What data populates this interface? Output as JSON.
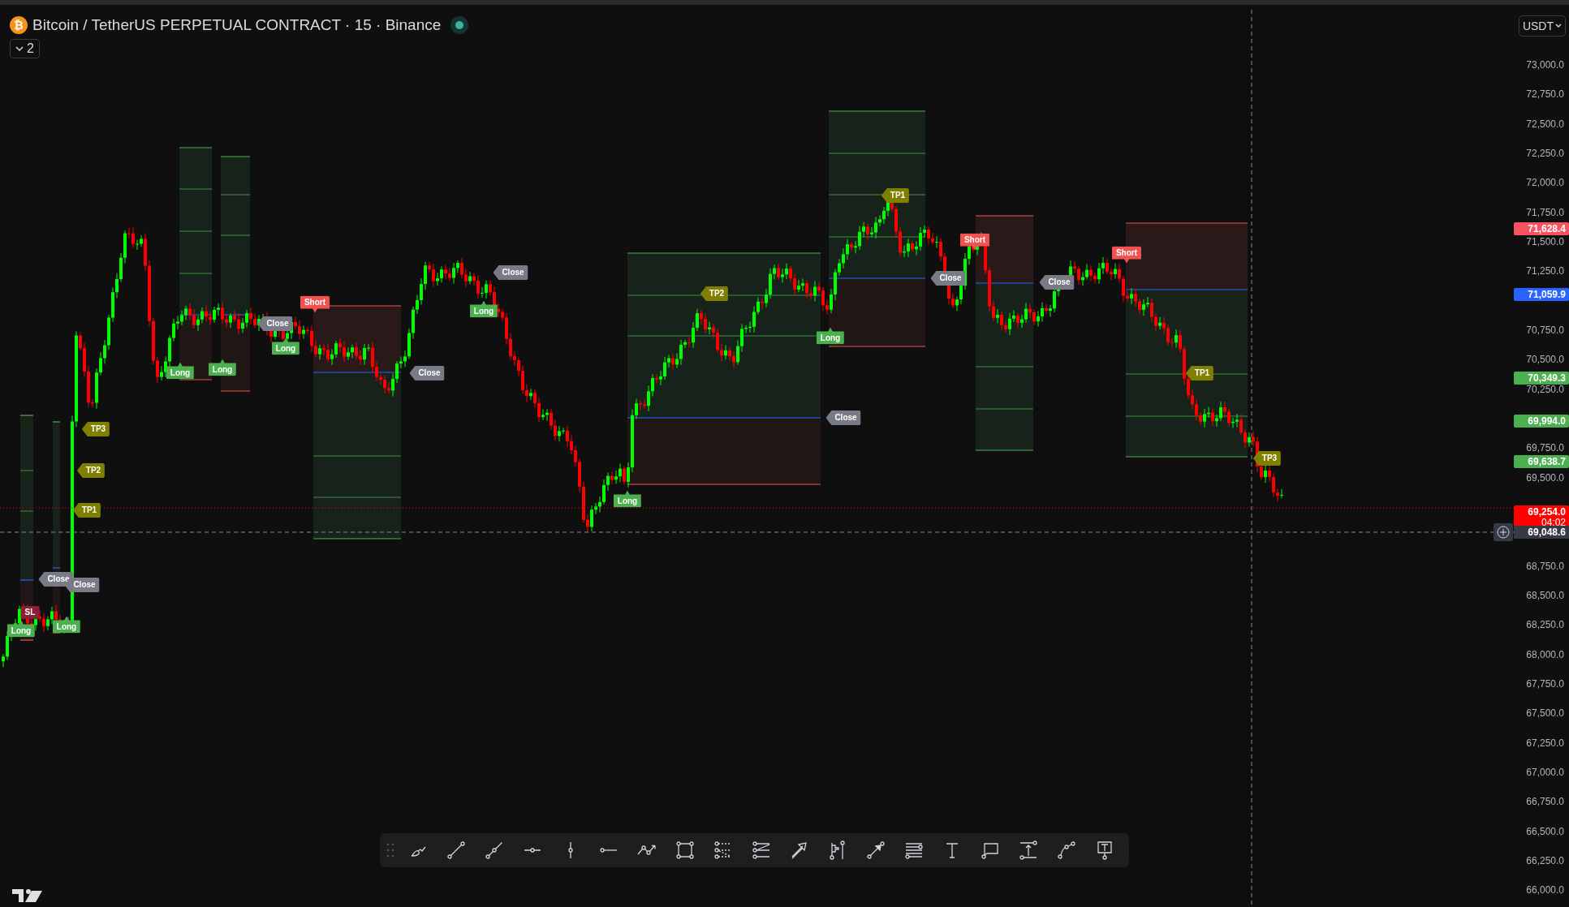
{
  "header": {
    "coin_symbol": "₿",
    "title": "Bitcoin / TetherUS PERPETUAL CONTRACT · 15 · Binance",
    "market_open": true,
    "indicator_count": "2"
  },
  "currency_menu": {
    "label": "USDT"
  },
  "price_axis": {
    "ticks": [
      "73,000.0",
      "72,750.0",
      "72,500.0",
      "72,250.0",
      "72,000.0",
      "71,750.0",
      "71,500.0",
      "71,250.0",
      "70,750.0",
      "70,500.0",
      "70,250.0",
      "69,750.0",
      "69,500.0",
      "68,750.0",
      "68,500.0",
      "68,250.0",
      "68,000.0",
      "67,750.0",
      "67,500.0",
      "67,250.0",
      "67,000.0",
      "66,750.0",
      "66,500.0",
      "66,250.0",
      "66,000.0"
    ],
    "badges": [
      {
        "text": "71,628.4",
        "color": "#f7525f"
      },
      {
        "text": "71,059.9",
        "color": "#2962ff"
      },
      {
        "text": "70,349.3",
        "color": "#4caf50"
      },
      {
        "text": "69,994.0",
        "color": "#4caf50"
      },
      {
        "text": "69,638.7",
        "color": "#4caf50"
      },
      {
        "text": "69,254.0",
        "countdown": "04:02",
        "color": "#ff0000"
      }
    ],
    "crosshair_price": "69,048.6"
  },
  "markers": [
    {
      "label": "TP3",
      "kind": "tp"
    },
    {
      "label": "TP2",
      "kind": "tp"
    },
    {
      "label": "TP1",
      "kind": "tp"
    },
    {
      "label": "Close",
      "kind": "close"
    },
    {
      "label": "Close",
      "kind": "close"
    },
    {
      "label": "SL",
      "kind": "sl"
    },
    {
      "label": "Long",
      "kind": "long"
    },
    {
      "label": "Long",
      "kind": "long"
    },
    {
      "label": "Long",
      "kind": "long"
    },
    {
      "label": "Long",
      "kind": "long"
    },
    {
      "label": "Close",
      "kind": "close"
    },
    {
      "label": "Short",
      "kind": "short"
    },
    {
      "label": "Close",
      "kind": "close"
    },
    {
      "label": "Long",
      "kind": "long"
    },
    {
      "label": "Close",
      "kind": "close"
    },
    {
      "label": "Long",
      "kind": "long"
    },
    {
      "label": "Long",
      "kind": "long"
    },
    {
      "label": "TP2",
      "kind": "tp"
    },
    {
      "label": "Close",
      "kind": "close"
    },
    {
      "label": "Long",
      "kind": "long"
    },
    {
      "label": "TP1",
      "kind": "tp"
    },
    {
      "label": "Close",
      "kind": "close"
    },
    {
      "label": "Short",
      "kind": "short"
    },
    {
      "label": "Close",
      "kind": "close"
    },
    {
      "label": "Short",
      "kind": "short"
    },
    {
      "label": "TP1",
      "kind": "tp"
    },
    {
      "label": "TP3",
      "kind": "tp"
    }
  ],
  "drawing_toolbar": {
    "tools": [
      {
        "kind": "grip"
      },
      {
        "kind": "brush"
      },
      {
        "kind": "trend-line"
      },
      {
        "kind": "ray"
      },
      {
        "kind": "horizontal-ray"
      },
      {
        "kind": "vertical-line"
      },
      {
        "kind": "horizontal-line"
      },
      {
        "kind": "path"
      },
      {
        "kind": "rectangle"
      },
      {
        "kind": "fib-retracement"
      },
      {
        "kind": "fib-extension"
      },
      {
        "kind": "arrow"
      },
      {
        "kind": "position"
      },
      {
        "kind": "arrow-marker"
      },
      {
        "kind": "parallel-lines"
      },
      {
        "kind": "text"
      },
      {
        "kind": "callout"
      },
      {
        "kind": "price-range"
      },
      {
        "kind": "curve"
      },
      {
        "kind": "text-note"
      }
    ]
  }
}
